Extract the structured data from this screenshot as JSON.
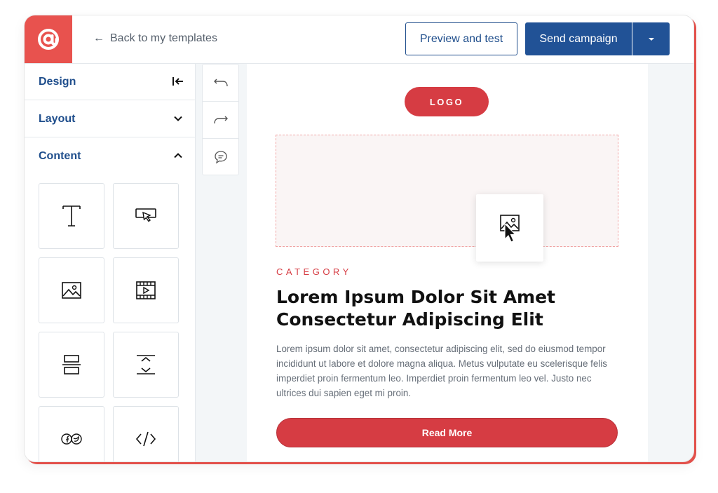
{
  "header": {
    "back_label": "Back to my templates",
    "preview_label": "Preview and test",
    "send_label": "Send campaign"
  },
  "sidebar": {
    "sections": [
      {
        "label": "Design",
        "icon": "collapse-left-icon"
      },
      {
        "label": "Layout",
        "icon": "chevron-down-icon"
      },
      {
        "label": "Content",
        "icon": "chevron-up-icon"
      }
    ],
    "content_tiles": [
      {
        "icon": "text-icon"
      },
      {
        "icon": "button-icon"
      },
      {
        "icon": "image-icon"
      },
      {
        "icon": "video-icon"
      },
      {
        "icon": "divider-icon"
      },
      {
        "icon": "spacer-icon"
      },
      {
        "icon": "social-icon"
      },
      {
        "icon": "code-icon"
      }
    ]
  },
  "tools": [
    {
      "icon": "undo-icon"
    },
    {
      "icon": "redo-icon"
    },
    {
      "icon": "comment-icon"
    }
  ],
  "email": {
    "logo_label": "LOGO",
    "category": "CATEGORY",
    "headline": "Lorem Ipsum Dolor Sit Amet Consectetur Adipiscing Elit",
    "body": "Lorem ipsum dolor sit amet, consectetur adipiscing elit, sed do eiusmod tempor incididunt ut labore et dolore magna aliqua. Metus vulputate eu scelerisque felis imperdiet proin fermentum leo. Imperdiet proin fermentum leo vel. Justo nec ultrices dui sapien eget mi proin.",
    "cta_label": "Read More"
  },
  "colors": {
    "brand_red": "#e8524e",
    "accent_red": "#d63c43",
    "primary_blue": "#215296",
    "nav_blue": "#1f4e8c"
  }
}
